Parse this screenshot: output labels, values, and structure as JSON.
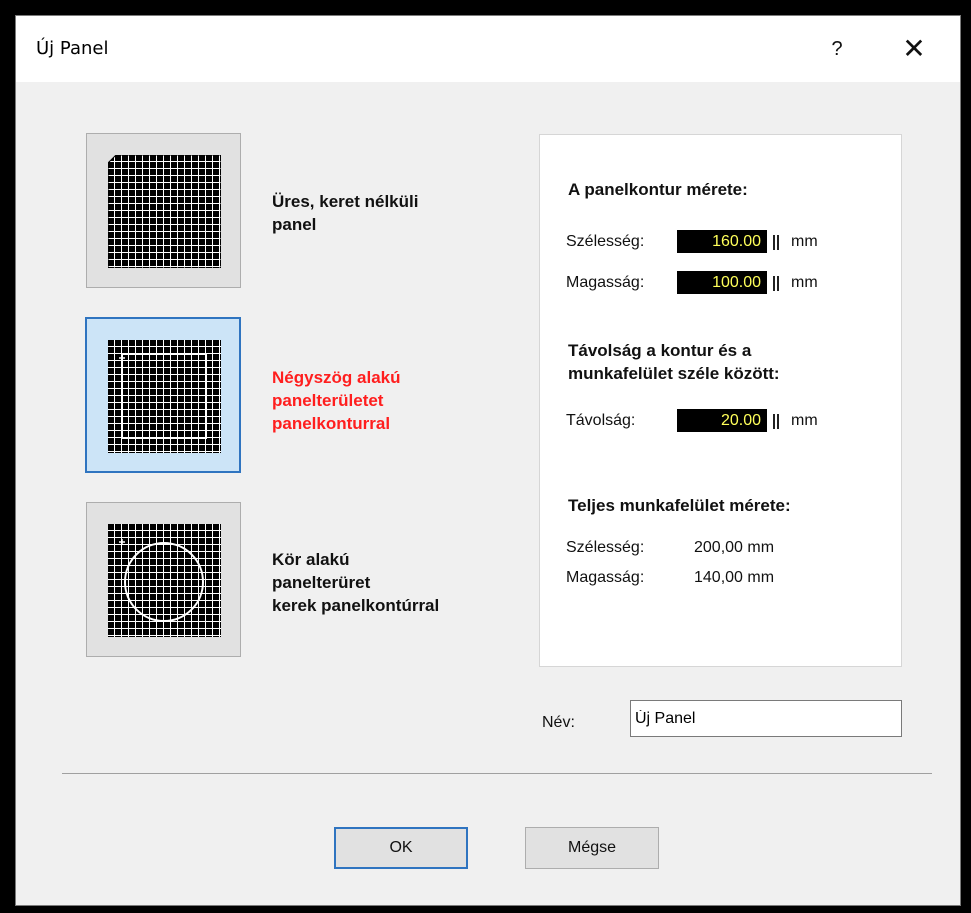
{
  "window": {
    "title": "Új Panel",
    "help_label": "?",
    "close_label": "✕"
  },
  "options": [
    {
      "label_lines": [
        "Üres, keret nélküli",
        "panel"
      ],
      "selected": false
    },
    {
      "label_lines": [
        "Négyszög alakú",
        "panelterületet",
        "panelkonturral"
      ],
      "selected": true
    },
    {
      "label_lines": [
        "Kör alakú",
        "panelterüret",
        "kerek panelkontúrral"
      ],
      "selected": false
    }
  ],
  "contour": {
    "heading": "A panelkontur mérete:",
    "width_label": "Szélesség:",
    "width_value": "160.00",
    "height_label": "Magasság:",
    "height_value": "100.00",
    "unit": "mm"
  },
  "distance": {
    "heading_line1": "Távolság a kontur és a",
    "heading_line2": "munkafelület széle között:",
    "label": "Távolság:",
    "value": "20.00",
    "unit": "mm"
  },
  "total": {
    "heading": "Teljes munkafelület mérete:",
    "width_label": "Szélesség:",
    "width_value": "200,00 mm",
    "height_label": "Magasság:",
    "height_value": "140,00 mm"
  },
  "name": {
    "label": "Név:",
    "value": "Új Panel"
  },
  "buttons": {
    "ok": "OK",
    "cancel": "Mégse"
  },
  "colors": {
    "accent": "#2f74c0",
    "selected_tile_bg": "#cce4f7",
    "active_label": "#ff1e1e",
    "field_bg": "#000000",
    "field_text": "#ffff5a"
  },
  "icons": {
    "help": "help-icon",
    "close": "close-icon",
    "spin": "spin-arrows-icon"
  }
}
